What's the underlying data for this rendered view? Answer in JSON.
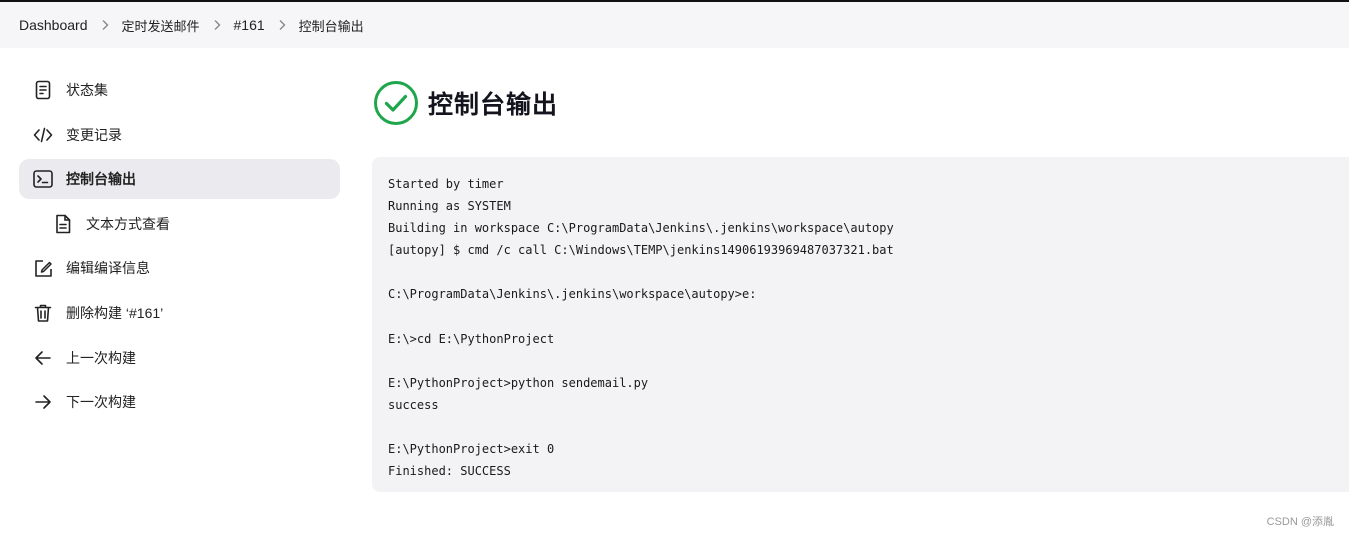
{
  "breadcrumb": {
    "items": [
      "Dashboard",
      "定时发送邮件",
      "#161",
      "控制台输出"
    ]
  },
  "sidebar": {
    "items": [
      {
        "label": "状态集",
        "icon": "document-icon"
      },
      {
        "label": "变更记录",
        "icon": "code-icon"
      },
      {
        "label": "控制台输出",
        "icon": "terminal-icon",
        "active": true
      },
      {
        "label": "文本方式查看",
        "icon": "file-text-icon",
        "sub": true
      },
      {
        "label": "编辑编译信息",
        "icon": "edit-icon"
      },
      {
        "label": "删除构建 ‘#161’",
        "icon": "trash-icon"
      },
      {
        "label": "上一次构建",
        "icon": "arrow-left-icon"
      },
      {
        "label": "下一次构建",
        "icon": "arrow-right-icon"
      }
    ]
  },
  "page": {
    "title": "控制台输出",
    "status_color": "#1ea64b"
  },
  "console": {
    "lines": [
      "Started by timer",
      "Running as SYSTEM",
      "Building in workspace C:\\ProgramData\\Jenkins\\.jenkins\\workspace\\autopy",
      "[autopy] $ cmd /c call C:\\Windows\\TEMP\\jenkins14906193969487037321.bat",
      "",
      "C:\\ProgramData\\Jenkins\\.jenkins\\workspace\\autopy>e:",
      "",
      "E:\\>cd E:\\PythonProject",
      "",
      "E:\\PythonProject>python sendemail.py",
      "success",
      "",
      "E:\\PythonProject>exit 0",
      "Finished: SUCCESS"
    ]
  },
  "watermark": "CSDN @添胤"
}
